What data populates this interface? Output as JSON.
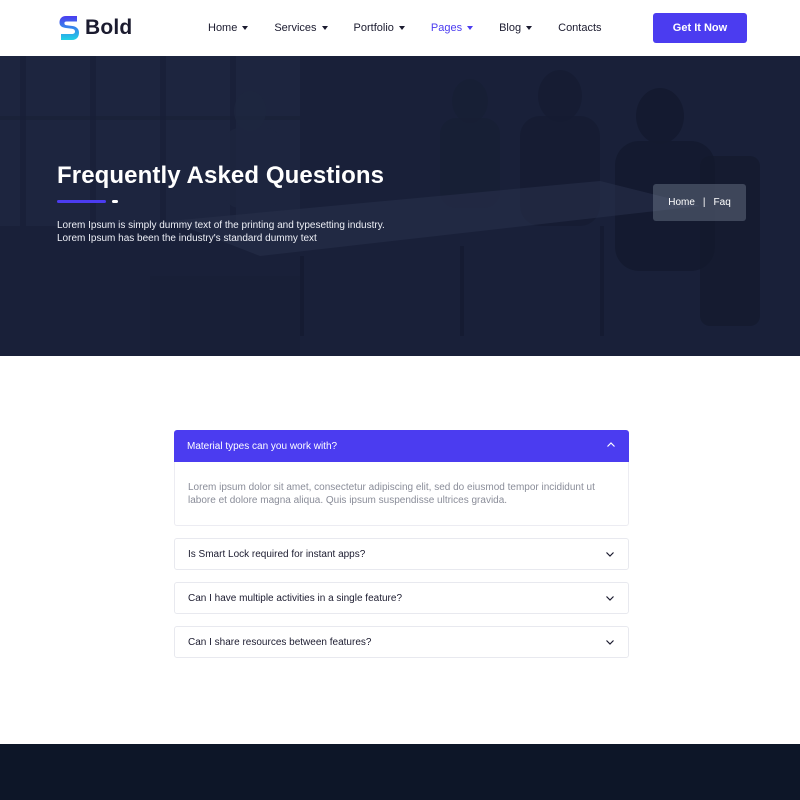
{
  "brand": {
    "name": "Bold",
    "accent": "#4b3cf0",
    "logo_gradient": [
      "#4b3cf0",
      "#20d3e6"
    ]
  },
  "nav": {
    "items": [
      {
        "label": "Home",
        "has_dropdown": true,
        "active": false
      },
      {
        "label": "Services",
        "has_dropdown": true,
        "active": false
      },
      {
        "label": "Portfolio",
        "has_dropdown": true,
        "active": false
      },
      {
        "label": "Pages",
        "has_dropdown": true,
        "active": true
      },
      {
        "label": "Blog",
        "has_dropdown": true,
        "active": false
      },
      {
        "label": "Contacts",
        "has_dropdown": false,
        "active": false
      }
    ],
    "cta_label": "Get It Now"
  },
  "hero": {
    "title": "Frequently Asked Questions",
    "description_line1": "Lorem Ipsum is simply dummy text of the printing and typesetting industry.",
    "description_line2": "Lorem Ipsum has been the industry's standard dummy text",
    "breadcrumb": {
      "home": "Home",
      "separator": "|",
      "current": "Faq"
    }
  },
  "faq": {
    "open": {
      "question": "Material types can you work with?",
      "answer": "Lorem ipsum dolor sit amet, consectetur adipiscing elit, sed do eiusmod tempor incididunt ut labore et dolore magna aliqua. Quis ipsum suspendisse ultrices gravida."
    },
    "items": [
      {
        "question": "Is Smart Lock required for instant apps?"
      },
      {
        "question": "Can I have multiple activities in a single feature?"
      },
      {
        "question": "Can I share resources between features?"
      }
    ]
  },
  "footer": {
    "background": "#0d1628"
  }
}
